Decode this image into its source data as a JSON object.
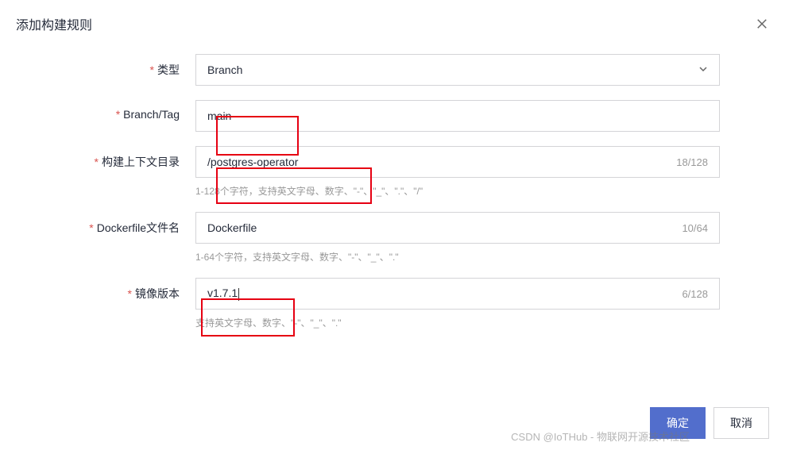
{
  "dialog": {
    "title": "添加构建规则"
  },
  "form": {
    "type_label": "类型",
    "type_value": "Branch",
    "branch_label": "Branch/Tag",
    "branch_value": "main",
    "context_label": "构建上下文目录",
    "context_value": "/postgres-operator",
    "context_counter": "18/128",
    "context_help": "1-128个字符，支持英文字母、数字、\"-\"、\"_\"、\".\"、\"/\"",
    "dockerfile_label": "Dockerfile文件名",
    "dockerfile_value": "Dockerfile",
    "dockerfile_counter": "10/64",
    "dockerfile_help": "1-64个字符，支持英文字母、数字、\"-\"、\"_\"、\".\"",
    "version_label": "镜像版本",
    "version_value": "v1.7.1",
    "version_counter": "6/128",
    "version_help": "支持英文字母、数字、\"-\"、\"_\"、\".\""
  },
  "buttons": {
    "ok": "确定",
    "cancel": "取消"
  },
  "watermark": "CSDN @IoTHub - 物联网开源技术社区"
}
